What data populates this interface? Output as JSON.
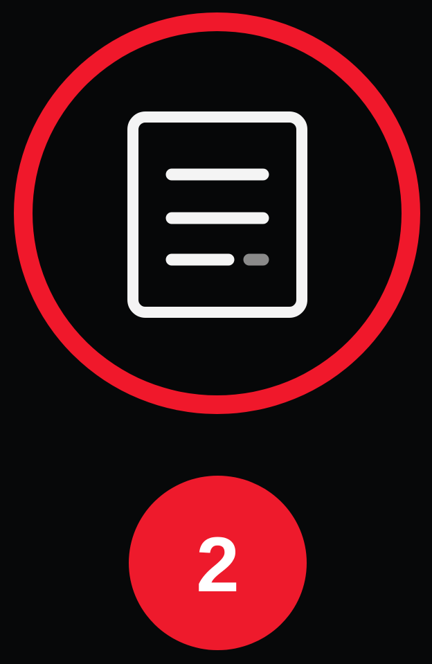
{
  "icon": {
    "name": "document-icon",
    "stroke_color": "#f4f4f4",
    "muted_color": "#8a8a8a"
  },
  "ring": {
    "color": "#f0182b"
  },
  "badge": {
    "number": "2",
    "color": "#ee1a2c",
    "text_color": "#ffffff"
  }
}
